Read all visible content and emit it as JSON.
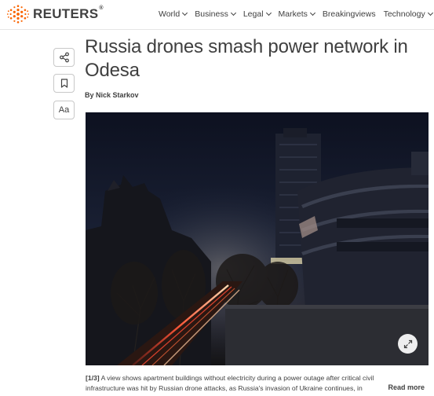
{
  "brand": {
    "name": "REUTERS",
    "trademark": "®",
    "logo_color": "#fa6400"
  },
  "nav": {
    "items": [
      {
        "label": "World"
      },
      {
        "label": "Business"
      },
      {
        "label": "Legal"
      },
      {
        "label": "Markets"
      },
      {
        "label": "Breakingviews",
        "no_chevron": true
      },
      {
        "label": "Technology"
      }
    ]
  },
  "tools": {
    "share_icon": "share-icon",
    "bookmark_icon": "bookmark-icon",
    "text_size_label": "Aa"
  },
  "article": {
    "headline": "Russia drones smash power network in Odesa",
    "byline": "By Nick Starkov",
    "image": {
      "expand_icon": "expand-icon"
    },
    "caption": {
      "count": "[1/3]",
      "text_line1": " A view shows apartment buildings without electricity during a power outage after critical civil",
      "text_line2": "infrastructure was hit by Russian drone attacks, as Russia's invasion of Ukraine continues, in"
    },
    "read_more": "Read more"
  }
}
